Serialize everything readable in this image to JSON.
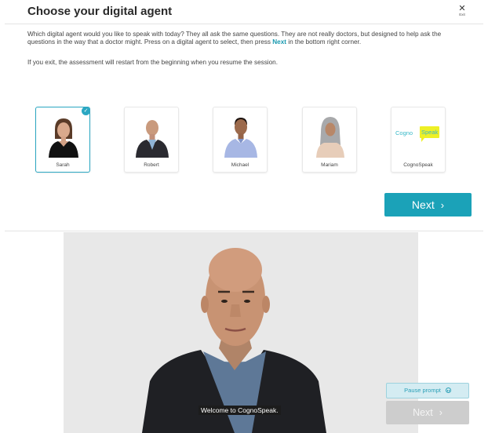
{
  "header": {
    "title": "Choose your digital agent",
    "exit_label": "Exit",
    "exit_glyph": "✕"
  },
  "intro": {
    "p1_part1": "Which digital agent would you like to speak with today? They all ask the same questions. They are not really doctors, but designed to help ask the questions in the way that a doctor might. Press on a digital agent to select, then press",
    "p1_next": "Next",
    "p1_part2": "in the bottom right corner.",
    "p2": "If you exit, the assessment will restart from the beginning when you resume the session."
  },
  "agents": [
    {
      "name": "Sarah",
      "selected": true
    },
    {
      "name": "Robert",
      "selected": false
    },
    {
      "name": "Michael",
      "selected": false
    },
    {
      "name": "Mariam",
      "selected": false
    },
    {
      "name": "CognoSpeak",
      "selected": false
    }
  ],
  "logo": {
    "part1": "Cogno",
    "part2": "Speak"
  },
  "next_button": {
    "label": "Next",
    "chevron": "›"
  },
  "video": {
    "subtitle": "Welcome to CognoSpeak."
  },
  "pause_button": {
    "label": "Pause prompt"
  },
  "next_disabled": {
    "label": "Next",
    "chevron": "›"
  },
  "colors": {
    "accent": "#1ba2b8",
    "selected_border": "#2aa7c2",
    "logo_yellow": "#eef025"
  }
}
